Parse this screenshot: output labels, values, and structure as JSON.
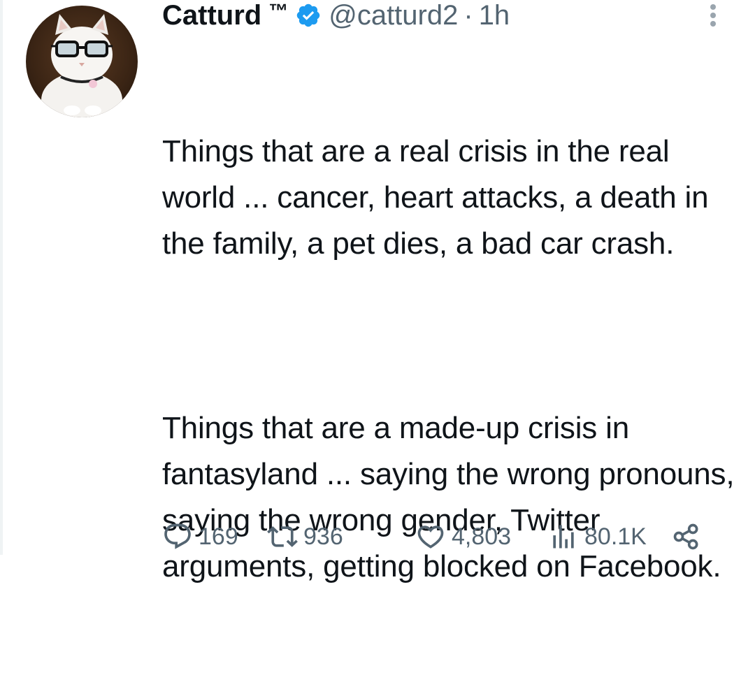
{
  "tweet": {
    "author": {
      "display_name": "Catturd",
      "trademark": "™",
      "handle": "@catturd2",
      "verified": true,
      "separator": "·",
      "time": "1h"
    },
    "paragraphs": [
      "Things that are a real crisis in the real world ... cancer, heart attacks, a death in the family, a pet dies, a bad car crash.",
      "Things that are a made-up crisis in fantasyland ... saying the wrong pronouns, saying the wrong gender, Twitter arguments, getting blocked on Facebook."
    ],
    "metrics": {
      "replies": "169",
      "retweets": "936",
      "likes": "4,803",
      "views": "80.1K"
    }
  },
  "colors": {
    "text": "#0f1419",
    "secondary": "#536471",
    "verified_blue": "#1d9bf0",
    "background": "#ffffff"
  },
  "icons": {
    "verified": "verified-badge-icon",
    "more": "more-dots-icon",
    "reply": "reply-icon",
    "retweet": "retweet-icon",
    "like": "heart-icon",
    "views": "views-bar-chart-icon",
    "share": "share-icon"
  }
}
